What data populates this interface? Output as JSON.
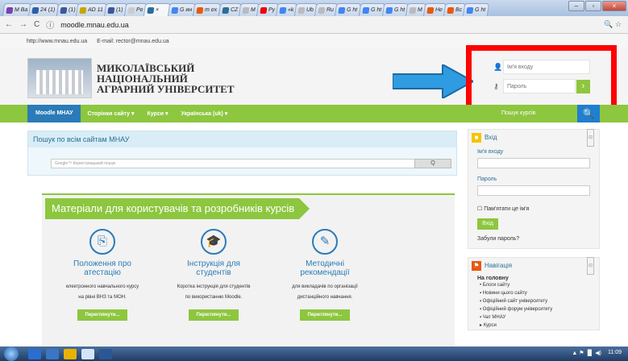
{
  "browser": {
    "tabs": [
      "M Ba",
      "24 (1)",
      "(1)",
      "AD 11",
      "(1)",
      "Pe",
      "",
      "G ин",
      "m ex",
      "CZ",
      "M",
      "Py",
      "«k",
      "Ub",
      "Ru",
      "G ht",
      "G ht",
      "G ht",
      "M",
      "Не",
      "Bc",
      "G ht"
    ],
    "active_tab": "×",
    "url": "moodle.mnau.edu.ua",
    "window_controls": [
      "–",
      "▫",
      "×"
    ]
  },
  "topbar": {
    "site": "http://www.mnau.edu.ua",
    "email": "E-mail: rector@mnau.edu.ua"
  },
  "brand": {
    "line1": "МИКОЛАЇВСЬКИЙ",
    "line2": "НАЦІОНАЛЬНИЙ",
    "line3": "АГРАРНИЙ УНІВЕРСИТЕТ"
  },
  "login_header": {
    "username_placeholder": "Ім'я входу",
    "password_placeholder": "Пароль",
    "go": "›"
  },
  "nav": {
    "items": [
      "Moodle МНАУ",
      "Сторінки сайту ▾",
      "Курси ▾",
      "Українська (uk) ▾"
    ],
    "search_label": "Пошук курсів",
    "search_icon": "🔍"
  },
  "site_search": {
    "title": "Пошук по всім сайтам МНАУ",
    "placeholder": "Google™ Користувацький пошук",
    "button": "Q"
  },
  "materials": {
    "title": "Матеріали для користувачів та розробників курсів",
    "columns": [
      {
        "icon": "⎘",
        "title1": "Положення про",
        "title2": "атестацію",
        "desc1": "електронного навчального курсу",
        "desc2": "на рівні ВНЗ та МОН.",
        "button": "Переглянути..."
      },
      {
        "icon": "🎓",
        "title1": "Інструкція для",
        "title2": "студентів",
        "desc1": "Коротка інструкція для студентів",
        "desc2": "по використанню Moodle.",
        "button": "Переглянути..."
      },
      {
        "icon": "✎",
        "title1": "Методичні",
        "title2": "рекомендації",
        "desc1": "для викладачів по організації",
        "desc2": "дистанційного навчання.",
        "button": "Переглянути..."
      }
    ]
  },
  "login_block": {
    "title": "Вхід",
    "username_label": "Ім'я входу",
    "password_label": "Пароль",
    "remember": "Пам'ятати це ім'я",
    "submit": "Вхід",
    "forgot": "Забули пароль?"
  },
  "nav_block": {
    "title": "Навігація",
    "home": "На головну",
    "items": [
      "Блоги сайту",
      "Новини цього сайту",
      "Офіційний сайт університету",
      "Офіційний форум університету",
      "Чат МНАУ",
      "Курси"
    ]
  },
  "taskbar": {
    "time": "11:09"
  },
  "colors": {
    "green": "#8dc63f",
    "blue": "#2a7bb8",
    "highlight": "#ff0000"
  }
}
